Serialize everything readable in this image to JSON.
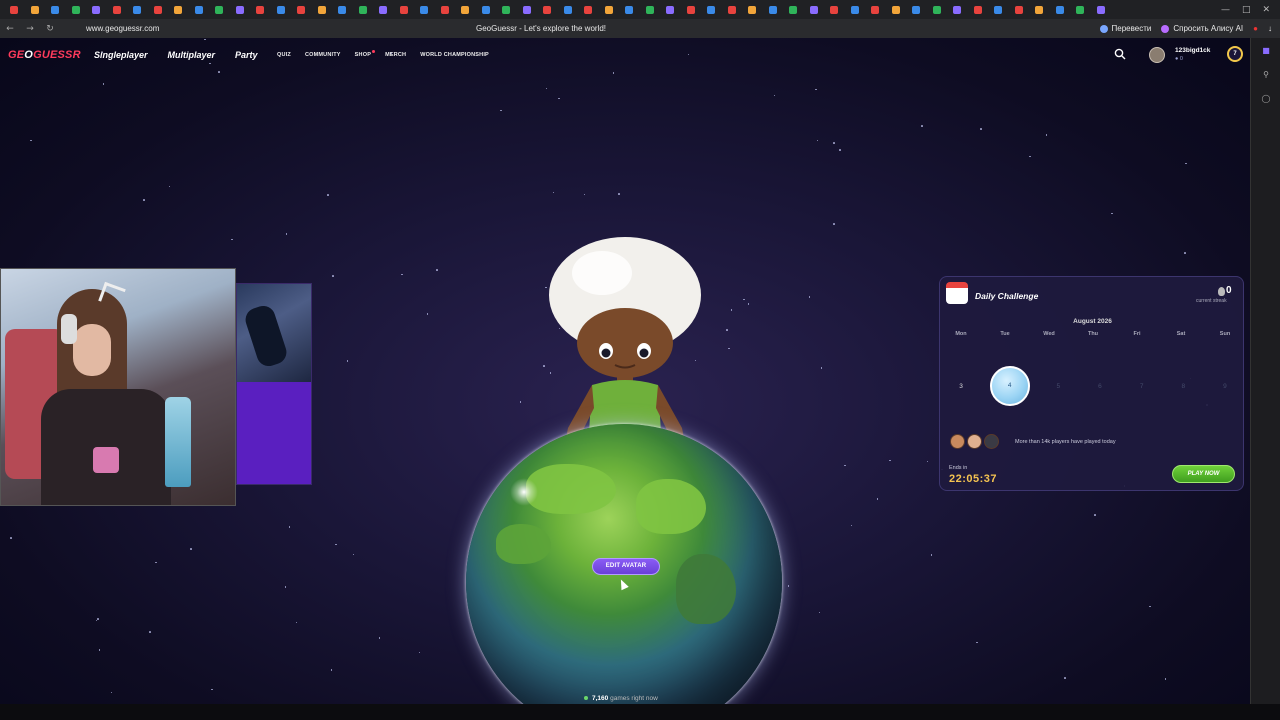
{
  "browser": {
    "url": "www.geoguessr.com",
    "page_title": "GeoGuessr - Let's explore the world!",
    "translate_label": "Перевести",
    "ask_alice_label": "Спросить Алису AI"
  },
  "header": {
    "logo_part1": "GE",
    "logo_part2": "O",
    "logo_part3": "GUESSR",
    "nav": [
      "Singleplayer",
      "Multiplayer",
      "Party"
    ],
    "subnav": [
      "QUIZ",
      "COMMUNITY",
      "SHOP",
      "MERCH",
      "WORLD CHAMPIONSHIP"
    ],
    "username": "123bigd1ck",
    "user_level": "0",
    "level_badge": "7"
  },
  "main": {
    "edit_avatar_label": "EDIT AVATAR",
    "games_count": "7,160",
    "games_suffix": " games right now",
    "social_icons": [
      "discord-icon",
      "reddit-icon",
      "youtube-icon",
      "facebook-icon",
      "instagram-icon",
      "x-icon",
      "twitch-icon",
      "tiktok-icon"
    ]
  },
  "daily_challenge": {
    "title": "Daily Challenge",
    "streak_value": "0",
    "streak_label": "current streak",
    "month": "August 2026",
    "weekdays": [
      "Mon",
      "Tue",
      "Wed",
      "Thu",
      "Fri",
      "Sat",
      "Sun"
    ],
    "dates": [
      "3",
      "4",
      "5",
      "6",
      "7",
      "8",
      "9"
    ],
    "players_text": "More than 14k players have played today",
    "ends_label": "Ends in",
    "timer": "22:05:37",
    "play_label": "PLAY NOW"
  },
  "colors": {
    "logo_red": "#ff3b5c",
    "timer_gold": "#f5c451",
    "play_green": "#4fb52a",
    "edit_purple": "#7a4ce6"
  }
}
